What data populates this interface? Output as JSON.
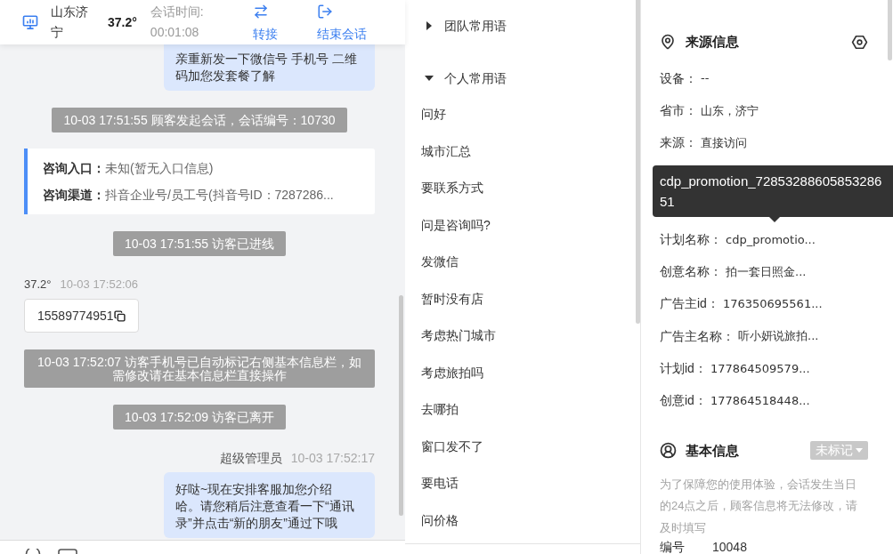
{
  "header": {
    "location": "山东济宁",
    "temperature": "37.2°",
    "session_time_label": "会话时间:",
    "session_time": "00:01:08",
    "actions": [
      {
        "kind": "transfer",
        "label": "转接"
      },
      {
        "kind": "end_session",
        "label": "结束会话"
      }
    ]
  },
  "chat": {
    "messages": [
      {
        "kind": "agent",
        "lines": [
          "亲重新发一下微信号 手机号 二维",
          "码加您发套餐了解"
        ]
      },
      {
        "kind": "notice",
        "text": "10-03 17:51:55 顾客发起会话，会话编号：10730"
      },
      {
        "kind": "entry_card",
        "rows": [
          {
            "label": "咨询入口：",
            "value": "未知(暂无入口信息)"
          },
          {
            "label": "咨询渠道：",
            "value": "抖音企业号/员工号(抖音号ID：7287286..."
          }
        ]
      },
      {
        "kind": "notice",
        "text": "10-03 17:51:55 访客已进线"
      },
      {
        "kind": "visitor",
        "sender": "37.2°",
        "time": "10-03 17:52:06",
        "text": "15589774951"
      },
      {
        "kind": "notice",
        "text": "10-03 17:52:07 访客手机号已自动标记右侧基本信息栏，如需修改请在基本信息栏直接操作"
      },
      {
        "kind": "notice",
        "text": "10-03 17:52:09 访客已离开"
      },
      {
        "kind": "agent",
        "sender": "超级管理员",
        "time": "10-03 17:52:17",
        "lines": [
          "好哒~现在安排客服加您介绍",
          "哈。请您稍后注意查看一下“通讯",
          "录”并点击“新的朋友”通过下哦"
        ]
      }
    ]
  },
  "quick_phrases": {
    "groups": [
      {
        "title": "团队常用语",
        "expanded": false
      },
      {
        "title": "个人常用语",
        "expanded": true,
        "items": [
          "问好",
          "城市汇总",
          "要联系方式",
          "问是咨询吗?",
          "发微信",
          "暂时没有店",
          "考虑热门城市",
          "考虑旅拍吗",
          "去哪拍",
          "窗口发不了",
          "要电话",
          "问价格"
        ]
      }
    ]
  },
  "source_info": {
    "title": "来源信息",
    "rows": [
      {
        "label": "设备：",
        "value": "--"
      },
      {
        "label": "省市：",
        "value": "山东，济宁"
      },
      {
        "label": "来源：",
        "value": "直接访问"
      },
      {
        "label": "计划名称：",
        "value": "cdp_promotio...",
        "tooltip": "cdp_promotion_7285328860585328651"
      },
      {
        "label": "创意名称：",
        "value": "拍一套日照金..."
      },
      {
        "label": "广告主id：",
        "value": "176350695561..."
      },
      {
        "label": "广告主名称：",
        "value": "听小妍说旅拍..."
      },
      {
        "label": "计划id：",
        "value": "177864509579..."
      },
      {
        "label": "创意id：",
        "value": "177864518448..."
      }
    ]
  },
  "basic_info": {
    "title": "基本信息",
    "tag": "未标记",
    "notice": "为了保障您的使用体验，会话发生当日的24点之后，顾客信息将无法修改，请及时填写",
    "fields": [
      {
        "label": "编号",
        "value": "10048"
      }
    ]
  }
}
